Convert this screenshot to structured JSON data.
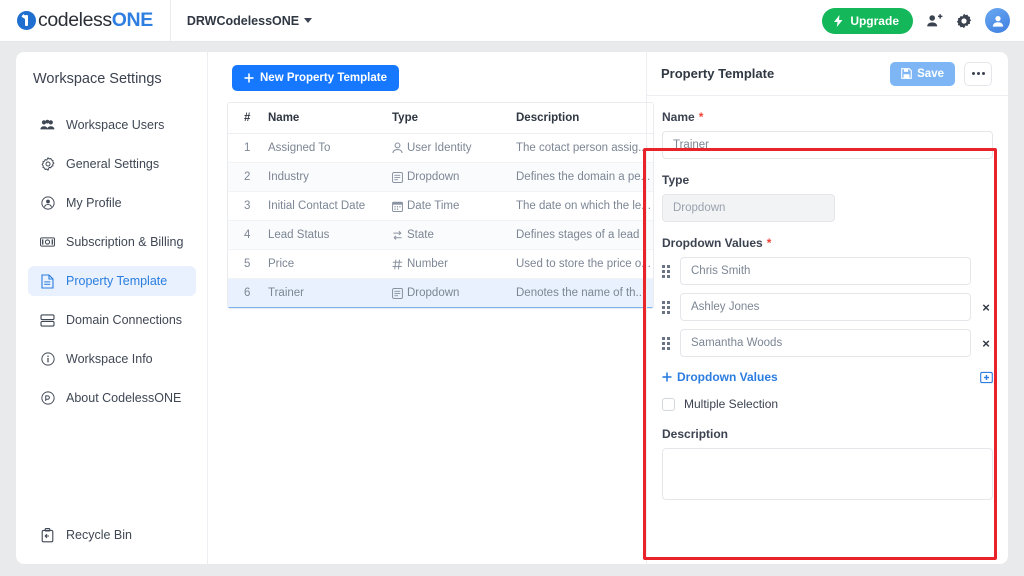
{
  "topbar": {
    "logo": {
      "part1": "codeless",
      "part2": "ONE",
      "icon": "logo-mark-icon"
    },
    "workspace_name": "DRWCodelessONE",
    "upgrade_label": "Upgrade",
    "icons": [
      "lightning-icon",
      "add-user-icon",
      "gear-icon",
      "avatar-icon"
    ]
  },
  "sidebar": {
    "title": "Workspace Settings",
    "items": [
      {
        "label": "Workspace Users",
        "icon": "users-icon",
        "active": false
      },
      {
        "label": "General Settings",
        "icon": "gear-icon",
        "active": false
      },
      {
        "label": "My Profile",
        "icon": "user-circle-icon",
        "active": false
      },
      {
        "label": "Subscription & Billing",
        "icon": "billing-icon",
        "active": false
      },
      {
        "label": "Property Template",
        "icon": "document-icon",
        "active": true
      },
      {
        "label": "Domain Connections",
        "icon": "stack-icon",
        "active": false
      },
      {
        "label": "Workspace Info",
        "icon": "info-icon",
        "active": false
      },
      {
        "label": "About CodelessONE",
        "icon": "about-icon",
        "active": false
      }
    ],
    "recycle_bin": {
      "label": "Recycle Bin",
      "icon": "recycle-bin-icon"
    }
  },
  "main": {
    "new_button_label": "New Property Template",
    "table": {
      "headers": [
        "#",
        "Name",
        "Type",
        "Description"
      ],
      "rows": [
        {
          "num": "1",
          "name": "Assigned To",
          "type": "User Identity",
          "type_icon": "user-identity-icon",
          "description": "The cotact person assig...",
          "selected": false
        },
        {
          "num": "2",
          "name": "Industry",
          "type": "Dropdown",
          "type_icon": "dropdown-icon",
          "description": "Defines the domain a pe...",
          "selected": false
        },
        {
          "num": "3",
          "name": "Initial Contact Date",
          "type": "Date Time",
          "type_icon": "calendar-icon",
          "description": "The date on which the le...",
          "selected": false
        },
        {
          "num": "4",
          "name": "Lead Status",
          "type": "State",
          "type_icon": "state-icon",
          "description": "Defines stages of a lead",
          "selected": false
        },
        {
          "num": "5",
          "name": "Price",
          "type": "Number",
          "type_icon": "hash-icon",
          "description": "Used to store the price o...",
          "selected": false
        },
        {
          "num": "6",
          "name": "Trainer",
          "type": "Dropdown",
          "type_icon": "dropdown-icon",
          "description": "Denotes the name of th...",
          "selected": true
        }
      ]
    }
  },
  "panel": {
    "title": "Property Template",
    "save_label": "Save",
    "save_icon": "floppy-disk-icon",
    "more_icon": "more-options-icon",
    "name_label": "Name",
    "name_value": "Trainer",
    "type_label": "Type",
    "type_value": "Dropdown",
    "dropdown_values_label": "Dropdown Values",
    "dropdown_values": [
      {
        "value": "Chris Smith",
        "removable": false
      },
      {
        "value": "Ashley Jones",
        "removable": true
      },
      {
        "value": "Samantha Woods",
        "removable": true
      }
    ],
    "remove_symbol": "×",
    "add_values_label": "Dropdown Values",
    "import_icon": "import-box-icon",
    "multiple_selection_label": "Multiple Selection",
    "multiple_selection_checked": false,
    "description_label": "Description",
    "description_value": "",
    "required_marker": "*"
  },
  "annotation": {
    "color": "#e8232a",
    "shape": "rectangle"
  }
}
